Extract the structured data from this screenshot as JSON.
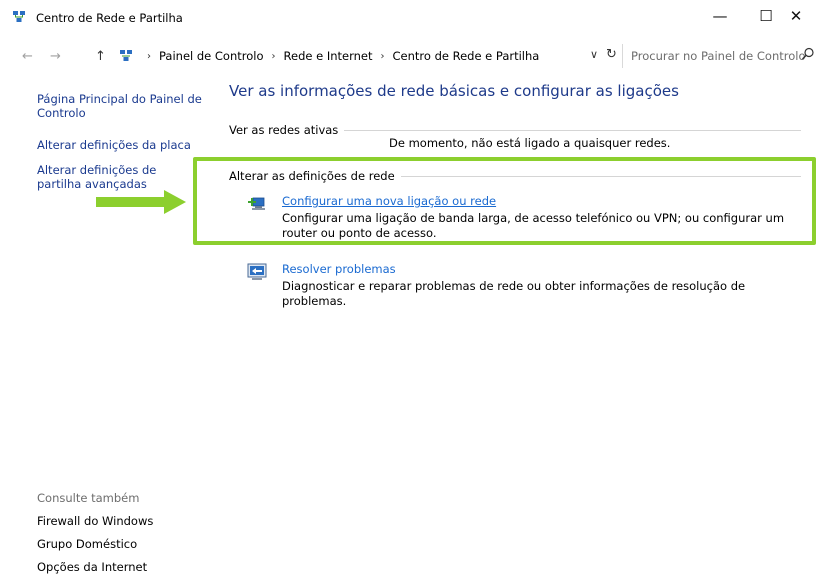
{
  "window": {
    "title": "Centro de Rede e Partilha",
    "controls": {
      "minimize": "—",
      "maximize": "☐",
      "close": "✕"
    }
  },
  "address": {
    "back": "←",
    "forward": "→",
    "up": "↑",
    "crumbs": [
      "Painel de Controlo",
      "Rede e Internet",
      "Centro de Rede e Partilha"
    ],
    "separator": "›",
    "dropdown": "∨",
    "refresh": "↻",
    "search_placeholder": "Procurar no Painel de Controlo"
  },
  "sidebar": {
    "links": [
      "Página Principal do Painel de Controlo",
      "Alterar definições da placa",
      "Alterar definições de partilha avançadas"
    ],
    "see_also_title": "Consulte também",
    "see_also": [
      "Firewall do Windows",
      "Grupo Doméstico",
      "Opções da Internet"
    ]
  },
  "main": {
    "title": "Ver as informações de rede básicas e configurar as ligações",
    "active_networks_header": "Ver as redes ativas",
    "no_network_text": "De momento, não está ligado a quaisquer redes.",
    "change_settings_header": "Alterar as definições de rede",
    "tasks": [
      {
        "icon": "network-setup-icon",
        "link": "Configurar uma nova ligação ou rede",
        "description": "Configurar uma ligação de banda larga, de acesso telefónico ou VPN; ou configurar um router ou ponto de acesso."
      },
      {
        "icon": "troubleshoot-icon",
        "link": "Resolver problemas",
        "description": "Diagnosticar e reparar problemas de rede ou obter informações de resolução de problemas."
      }
    ]
  },
  "colors": {
    "link": "#1a6ad1",
    "title_blue": "#1e3a8a",
    "highlight_green": "#8ccf2e"
  }
}
